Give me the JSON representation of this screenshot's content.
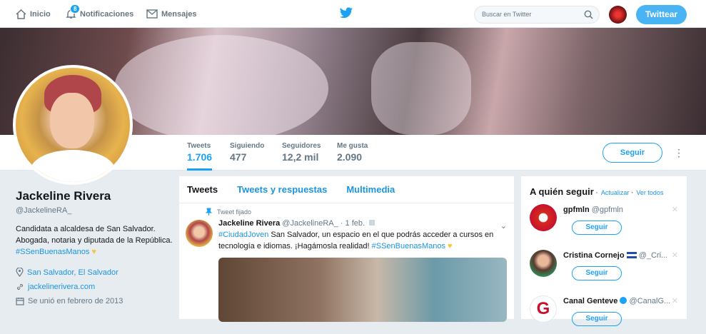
{
  "nav": {
    "home": "Inicio",
    "notifications": "Notificaciones",
    "notif_count": "8",
    "messages": "Mensajes"
  },
  "search": {
    "placeholder": "Buscar en Twitter"
  },
  "tweet_button": "Twittear",
  "stats": [
    {
      "label": "Tweets",
      "value": "1.706"
    },
    {
      "label": "Siguiendo",
      "value": "477"
    },
    {
      "label": "Seguidores",
      "value": "12,2 mil"
    },
    {
      "label": "Me gusta",
      "value": "2.090"
    }
  ],
  "follow_label": "Seguir",
  "profile": {
    "name": "Jackeline Rivera",
    "handle": "@JackelineRA_",
    "bio": "Candidata a alcaldesa de San Salvador. Abogada, notaria y diputada de la República.",
    "bio_hashtag": "#SSenBuenasManos",
    "location": "San Salvador, El Salvador",
    "website": "jackelinerivera.com",
    "joined": "Se unió en febrero de 2013"
  },
  "tabs": [
    "Tweets",
    "Tweets y respuestas",
    "Multimedia"
  ],
  "tweet": {
    "pinned": "Tweet fijado",
    "name": "Jackeline Rivera",
    "handle": "@JackelineRA_",
    "date": "· 1 feb.",
    "hashtag1": "#CiudadJoven",
    "text": "San Salvador, un espacio en el que podrás acceder a cursos en tecnología e idiomas. ¡Hagámosla realidad!",
    "hashtag2": "#SSenBuenasManos"
  },
  "who_to_follow": {
    "title": "A quién seguir",
    "refresh": "Actualizar",
    "view_all": "Ver todos",
    "accounts": [
      {
        "name": "gpfmln",
        "handle": "@gpfmln",
        "button": "Seguir"
      },
      {
        "name": "Cristina Cornejo",
        "handle": "@_Cri...",
        "button": "Seguir"
      },
      {
        "name": "Canal Genteve",
        "handle": "@CanalG...",
        "button": "Seguir"
      }
    ]
  },
  "colors": {
    "accent": "#1da1f2",
    "link": "#1b95e0"
  }
}
